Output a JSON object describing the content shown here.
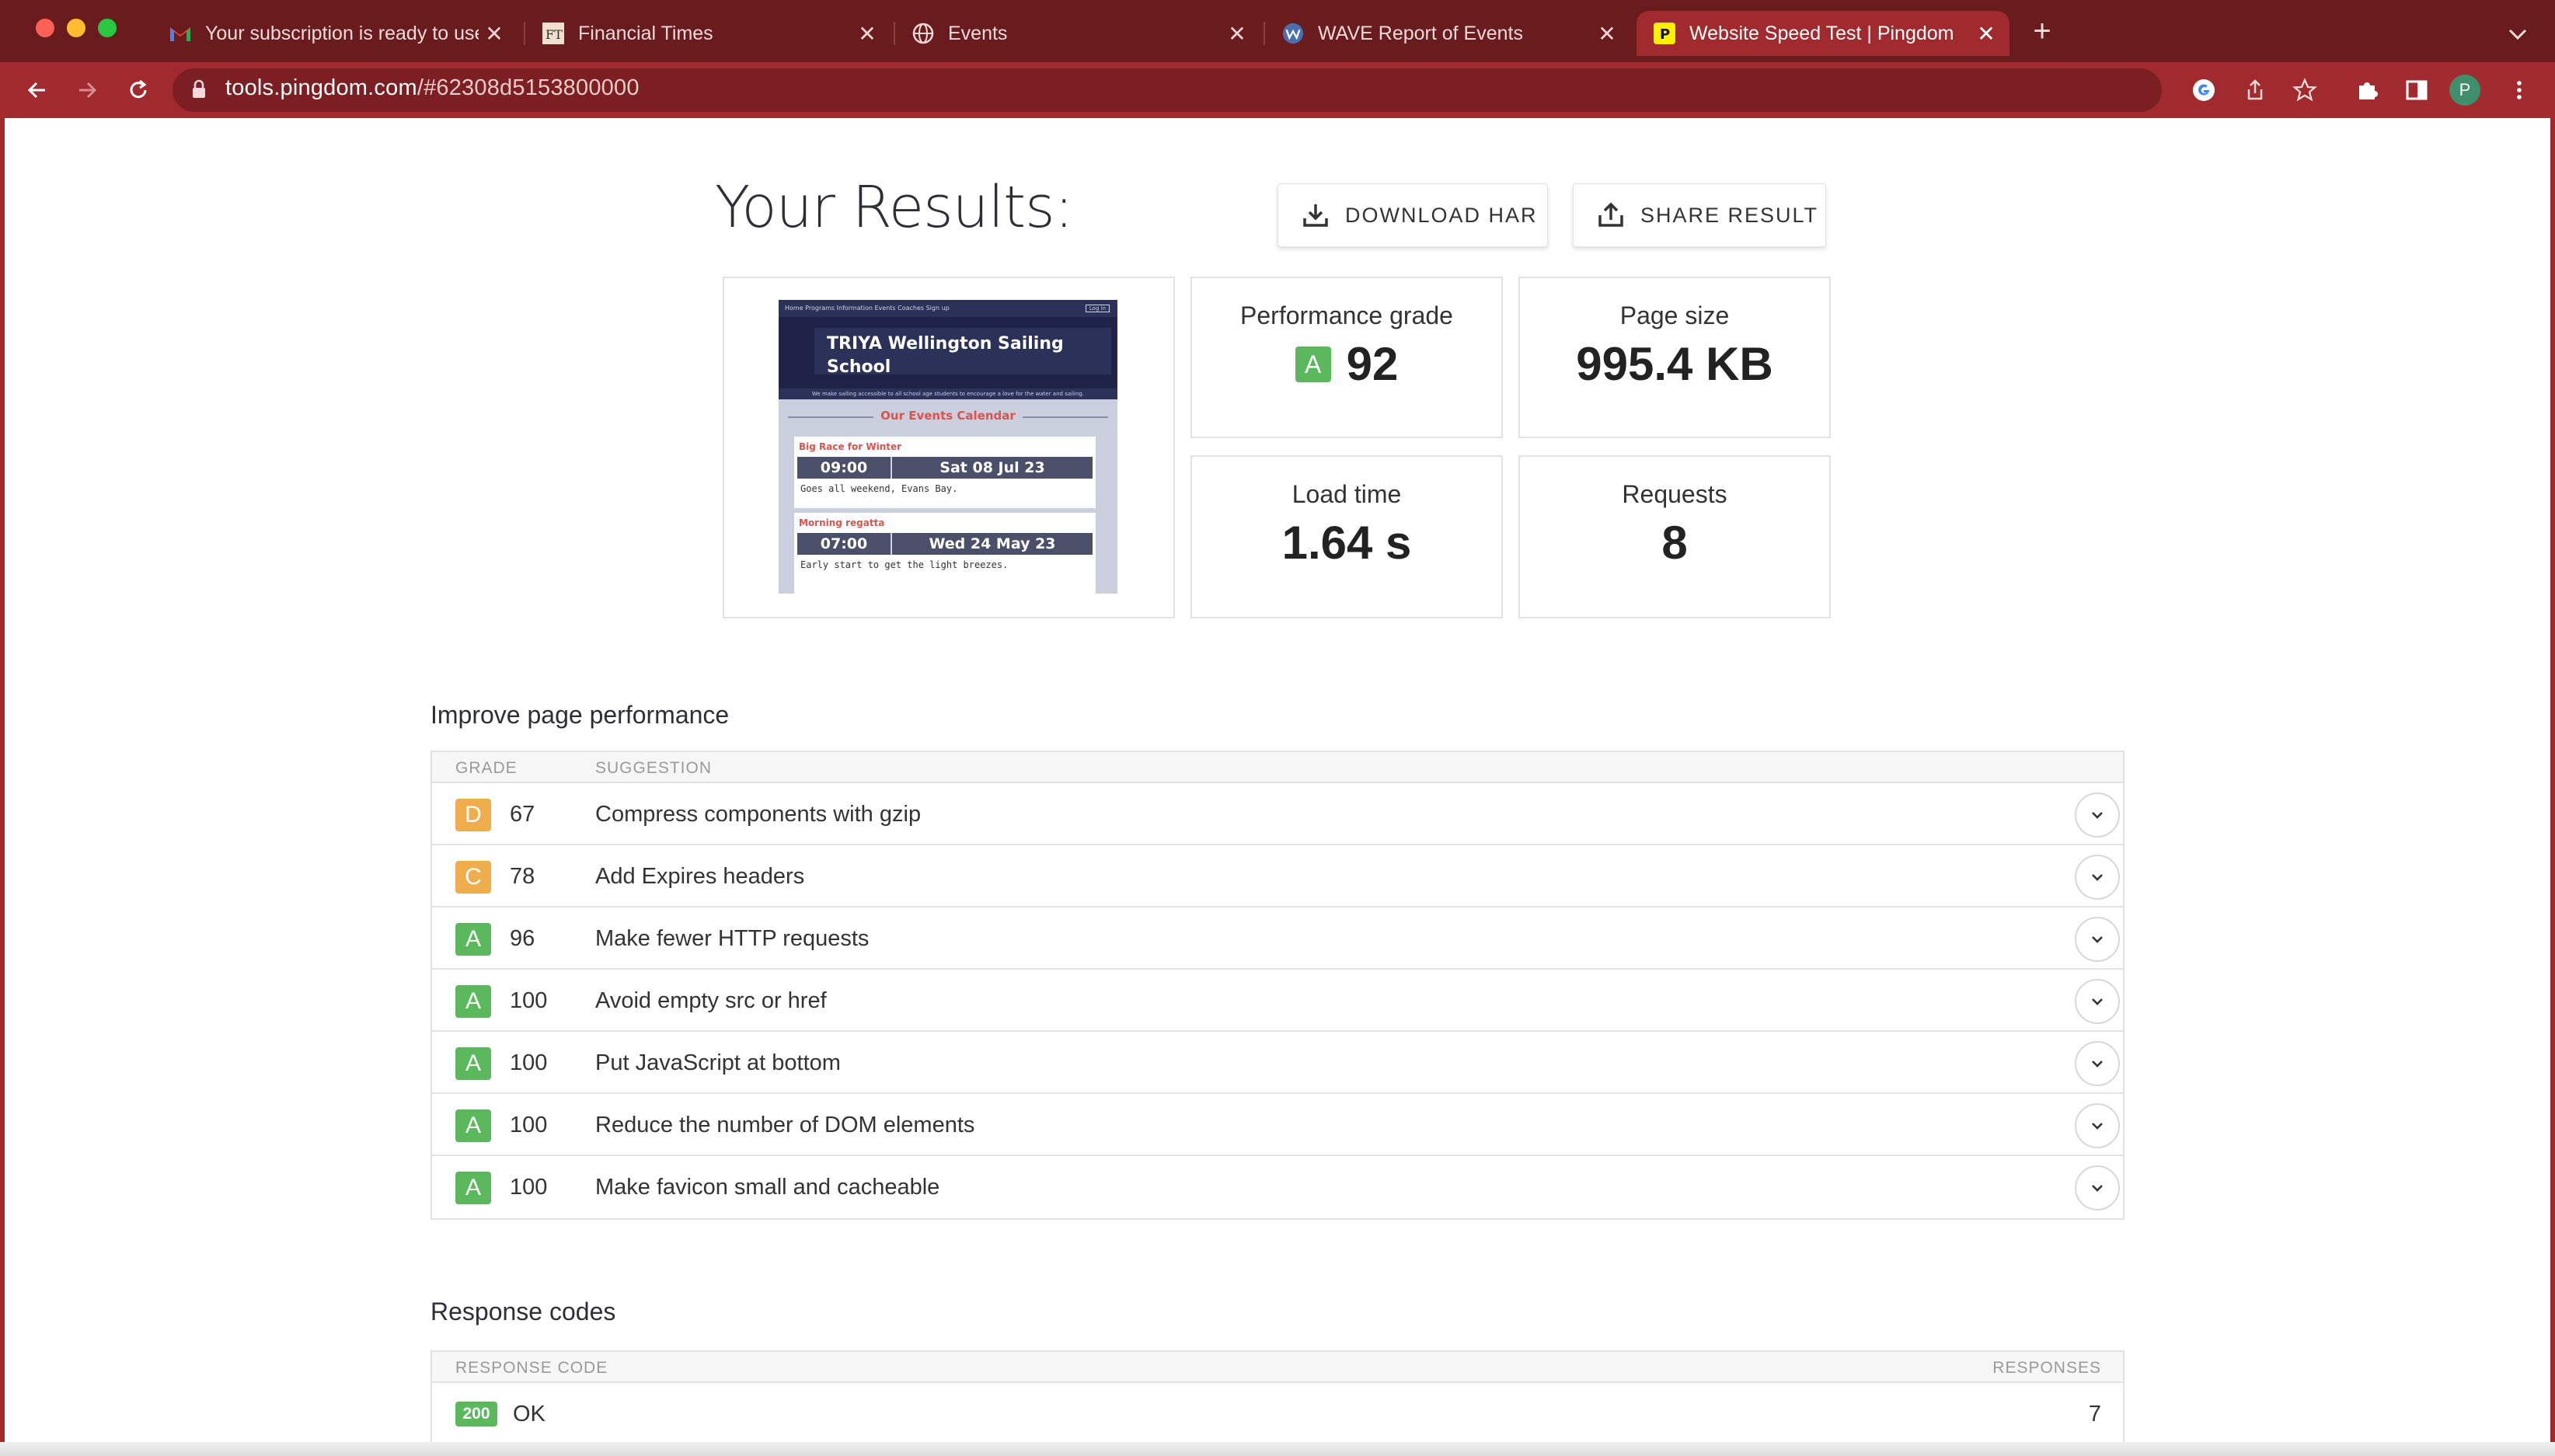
{
  "browser": {
    "tabs": [
      {
        "title": "Your subscription is ready to use",
        "icon": "gmail-icon"
      },
      {
        "title": "Financial Times",
        "icon": "ft-icon"
      },
      {
        "title": "Events",
        "icon": "globe-icon"
      },
      {
        "title": "WAVE Report of Events",
        "icon": "wave-icon"
      },
      {
        "title": "Website Speed Test | Pingdom",
        "icon": "pingdom-icon",
        "active": true
      }
    ],
    "url_host": "tools.pingdom.com",
    "url_path": "/#62308d5153800000",
    "profile_initial": "P"
  },
  "results": {
    "title": "Your Results:",
    "download_har": "DOWNLOAD HAR",
    "share_result": "SHARE RESULT"
  },
  "metrics": {
    "performance_grade_label": "Performance grade",
    "performance_grade_letter": "A",
    "performance_grade_value": "92",
    "page_size_label": "Page size",
    "page_size_value": "995.4 KB",
    "load_time_label": "Load time",
    "load_time_value": "1.64 s",
    "requests_label": "Requests",
    "requests_value": "8"
  },
  "thumbnail": {
    "nav_items": "Home   Programs   Information   Events   Coaches   Sign up",
    "login": "Log in",
    "site_title": "TRIYA Wellington Sailing School",
    "tagline": "We make sailing accessible to all school age students to encourage a love for the water and sailing.",
    "calendar_heading": "Our Events Calendar",
    "events": [
      {
        "name": "Big Race for Winter",
        "time": "09:00",
        "date": "Sat 08 Jul 23",
        "desc": "Goes all weekend, Evans Bay."
      },
      {
        "name": "Morning regatta",
        "time": "07:00",
        "date": "Wed 24 May 23",
        "desc": "Early start to get the light breezes."
      }
    ]
  },
  "improve": {
    "title": "Improve page performance",
    "col_grade": "GRADE",
    "col_suggestion": "SUGGESTION",
    "rows": [
      {
        "grade": "D",
        "score": "67",
        "suggestion": "Compress components with gzip",
        "color": "#f0ad4e"
      },
      {
        "grade": "C",
        "score": "78",
        "suggestion": "Add Expires headers",
        "color": "#f0ad4e"
      },
      {
        "grade": "A",
        "score": "96",
        "suggestion": "Make fewer HTTP requests",
        "color": "#5cb85c"
      },
      {
        "grade": "A",
        "score": "100",
        "suggestion": "Avoid empty src or href",
        "color": "#5cb85c"
      },
      {
        "grade": "A",
        "score": "100",
        "suggestion": "Put JavaScript at bottom",
        "color": "#5cb85c"
      },
      {
        "grade": "A",
        "score": "100",
        "suggestion": "Reduce the number of DOM elements",
        "color": "#5cb85c"
      },
      {
        "grade": "A",
        "score": "100",
        "suggestion": "Make favicon small and cacheable",
        "color": "#5cb85c"
      }
    ]
  },
  "response_codes": {
    "title": "Response codes",
    "col_code": "RESPONSE CODE",
    "col_responses": "RESPONSES",
    "rows": [
      {
        "code": "200",
        "text": "OK",
        "count": "7"
      }
    ]
  }
}
